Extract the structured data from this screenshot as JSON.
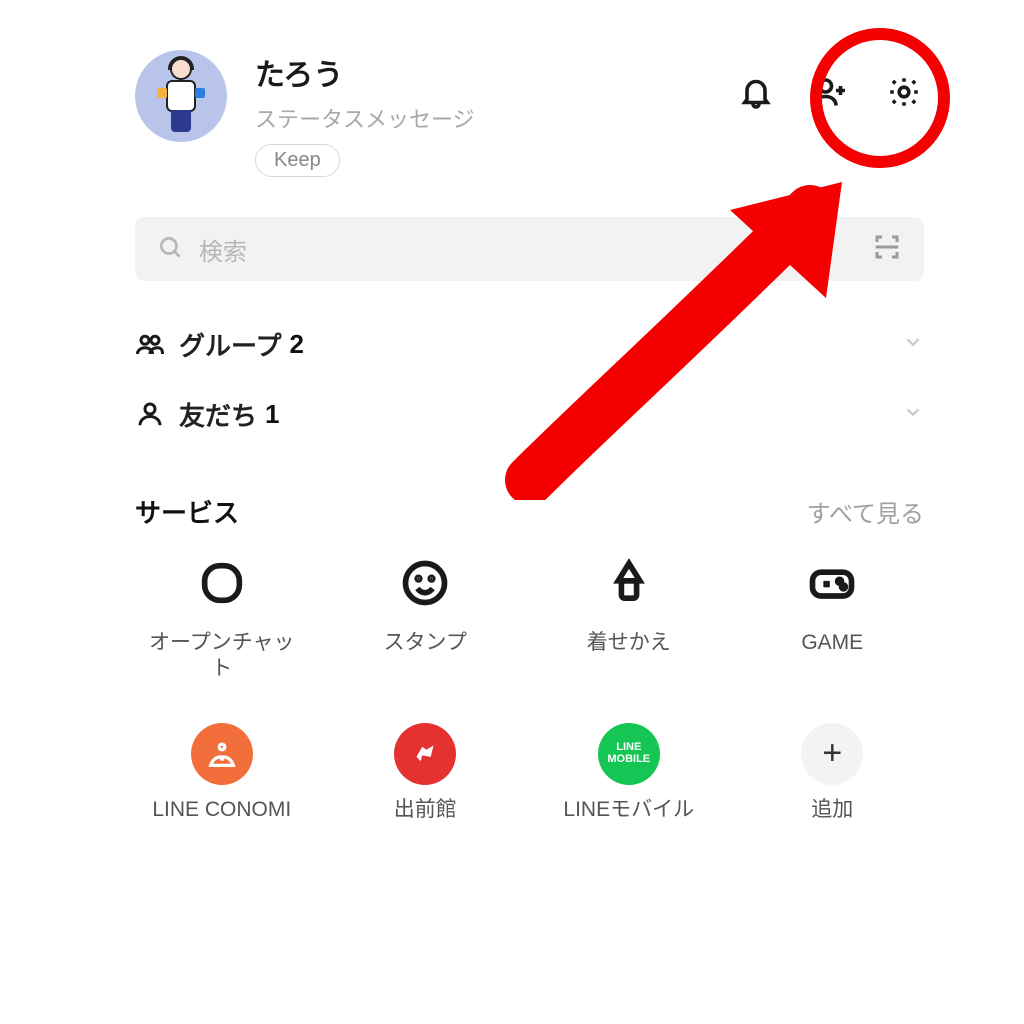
{
  "profile": {
    "name": "たろう",
    "status": "ステータスメッセージ",
    "keep_label": "Keep"
  },
  "search": {
    "placeholder": "検索"
  },
  "contacts": {
    "groups_label": "グループ",
    "groups_count": "2",
    "friends_label": "友だち",
    "friends_count": "1"
  },
  "services": {
    "title": "サービス",
    "see_all": "すべて見る",
    "items": [
      {
        "label": "オープンチャット"
      },
      {
        "label": "スタンプ"
      },
      {
        "label": "着せかえ"
      },
      {
        "label": "GAME"
      },
      {
        "label": "LINE CONOMI"
      },
      {
        "label": "出前館"
      },
      {
        "label": "LINEモバイル",
        "badge_text": "LINE\nMOBILE"
      },
      {
        "label": "追加"
      }
    ]
  },
  "annotation": {
    "target": "settings-icon",
    "color": "#f40000"
  }
}
